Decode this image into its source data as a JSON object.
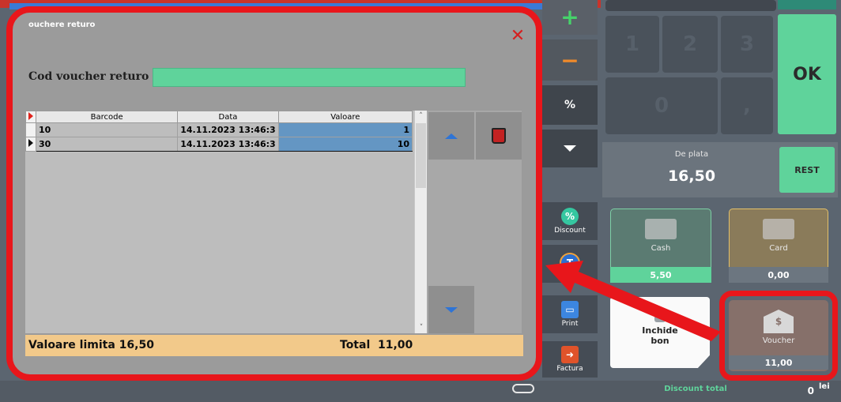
{
  "dialog": {
    "title": "ouchere returo",
    "code_label": "Cod voucher returo",
    "code_value": "",
    "columns": [
      "Barcode",
      "Data",
      "Valoare"
    ],
    "rows": [
      {
        "barcode": "10",
        "date": "14.11.2023 13:46:3",
        "value": "1"
      },
      {
        "barcode": "30",
        "date": "14.11.2023 13:46:3",
        "value": "10"
      }
    ],
    "limit_label": "Valoare limita 16,50",
    "total_label": "Total",
    "total_value": "11,00"
  },
  "keypad": {
    "plus": "+",
    "minus": "−",
    "percent": "%",
    "keys": [
      "1",
      "2",
      "3",
      "0",
      ","
    ],
    "ok": "OK"
  },
  "payment": {
    "due_label": "De plata",
    "due_value": "16,50",
    "rest": "REST",
    "cash_label": "Cash",
    "cash_value": "5,50",
    "card_label": "Card",
    "card_value": "0,00",
    "voucher_label": "Voucher",
    "voucher_value": "11,00",
    "close_label_1": "Inchide",
    "close_label_2": "bon"
  },
  "side": {
    "discount": "Discount",
    "print": "Print",
    "factura": "Factura"
  },
  "footer": {
    "discount_total_label": "Discount total",
    "discount_total_value": "0",
    "currency": "lei"
  },
  "colors": {
    "green": "#5fd39b",
    "red_outline": "#e8161b",
    "limit_bar": "#f2c98a",
    "selected_cell": "#6496c3"
  }
}
